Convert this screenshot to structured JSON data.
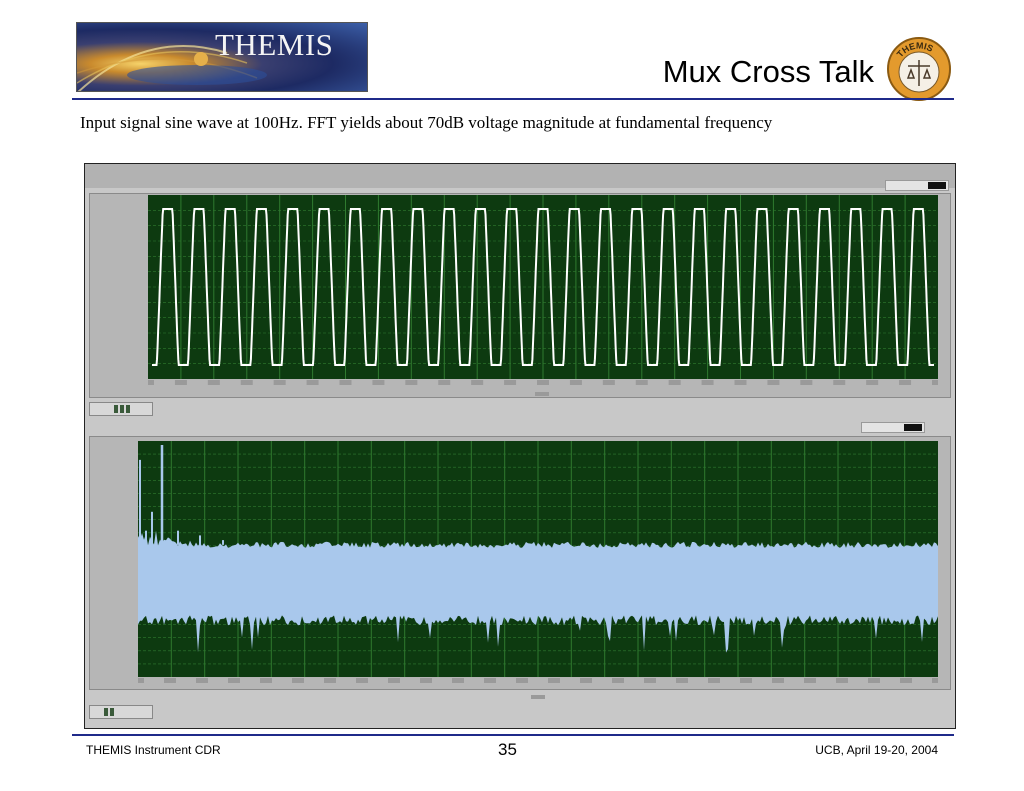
{
  "header": {
    "logo_text": "THEMIS",
    "title": "Mux Cross Talk",
    "seal_text": "THEMIS"
  },
  "subtitle": "Input signal sine wave at 100Hz. FFT yields about 70dB voltage magnitude at fundamental frequency",
  "footer": {
    "left": "THEMIS Instrument CDR",
    "page_number": "35",
    "right": "UCB, April 19-20, 2004"
  },
  "colors": {
    "plot_background": "#0d3a10",
    "grid": "#2f7a2f",
    "waveform": "#ffffff",
    "spectrum_fill": "#a9c8ec",
    "rule": "#1f2a8a"
  },
  "chart_data": [
    {
      "type": "line",
      "description_visible": "time-domain sine wave",
      "cycles_shown": 25,
      "amplitude": 1.0,
      "grid": true
    },
    {
      "type": "area",
      "description_visible": "FFT magnitude spectrum",
      "noise_floor_level": 0.3,
      "noise_band_top": 0.56,
      "noise_band_bottom": 0.24,
      "fundamental_peak": 1.0,
      "grid": true
    }
  ]
}
